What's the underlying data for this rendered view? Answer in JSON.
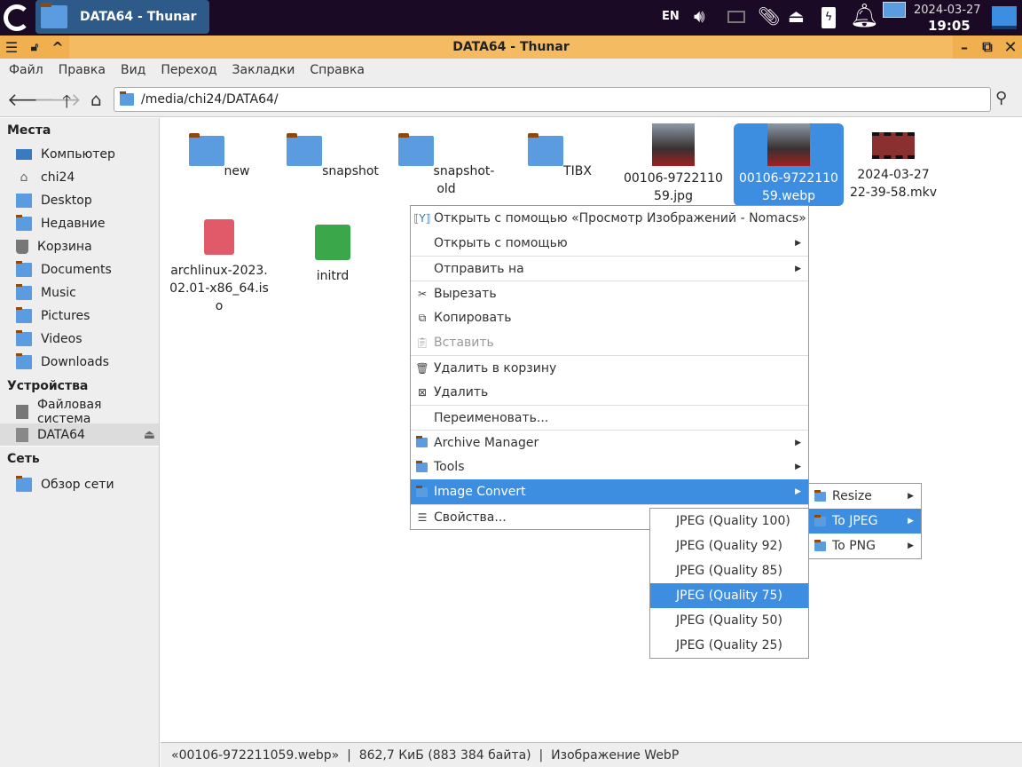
{
  "panel": {
    "task_title": "DATA64 - Thunar",
    "lang": "EN",
    "date": "2024-03-27",
    "time": "19:05"
  },
  "window": {
    "title": "DATA64 - Thunar"
  },
  "menubar": [
    "Файл",
    "Правка",
    "Вид",
    "Переход",
    "Закладки",
    "Справка"
  ],
  "location": "/media/chi24/DATA64/",
  "sidebar": {
    "places_header": "Места",
    "places": [
      "Компьютер",
      "chi24",
      "Desktop",
      "Недавние",
      "Корзина",
      "Documents",
      "Music",
      "Pictures",
      "Videos",
      "Downloads"
    ],
    "devices_header": "Устройства",
    "devices": [
      "Файловая система",
      "DATA64"
    ],
    "network_header": "Сеть",
    "network": [
      "Обзор сети"
    ]
  },
  "files": [
    {
      "name": "new",
      "type": "folder"
    },
    {
      "name": "snapshot",
      "type": "folder"
    },
    {
      "name": "snapshot-old",
      "type": "folder"
    },
    {
      "name": "TIBX",
      "type": "folder"
    },
    {
      "name": "00106-972211059.jpg",
      "type": "image"
    },
    {
      "name": "00106-972211059.webp",
      "type": "image"
    },
    {
      "name": "2024-03-27 22-39-58.mkv",
      "type": "video"
    },
    {
      "name": "archlinux-2023.02.01-x86_64.iso",
      "type": "iso"
    },
    {
      "name": "initrd",
      "type": "archive"
    }
  ],
  "context_menu": [
    "Открыть с помощью «Просмотр Изображений - Nomacs»",
    "Открыть с помощью",
    "Отправить на",
    "Вырезать",
    "Копировать",
    "Вставить",
    "Удалить в корзину",
    "Удалить",
    "Переименовать...",
    "Archive Manager",
    "Tools",
    "Image Convert",
    "Свойства..."
  ],
  "image_convert_menu": [
    "Resize",
    "To JPEG",
    "To PNG"
  ],
  "jpeg_menu": [
    "JPEG (Quality 100)",
    "JPEG (Quality 92)",
    "JPEG (Quality 85)",
    "JPEG (Quality 75)",
    "JPEG (Quality 50)",
    "JPEG (Quality 25)"
  ],
  "status": {
    "name": "«00106-972211059.webp»",
    "size": "862,7 КиБ (883 384 байта)",
    "type": "Изображение WebP",
    "sep": "|"
  },
  "colors": {
    "accent": "#3d8ee0",
    "titlebar": "#f4bb62",
    "panel": "#1a0a25"
  }
}
